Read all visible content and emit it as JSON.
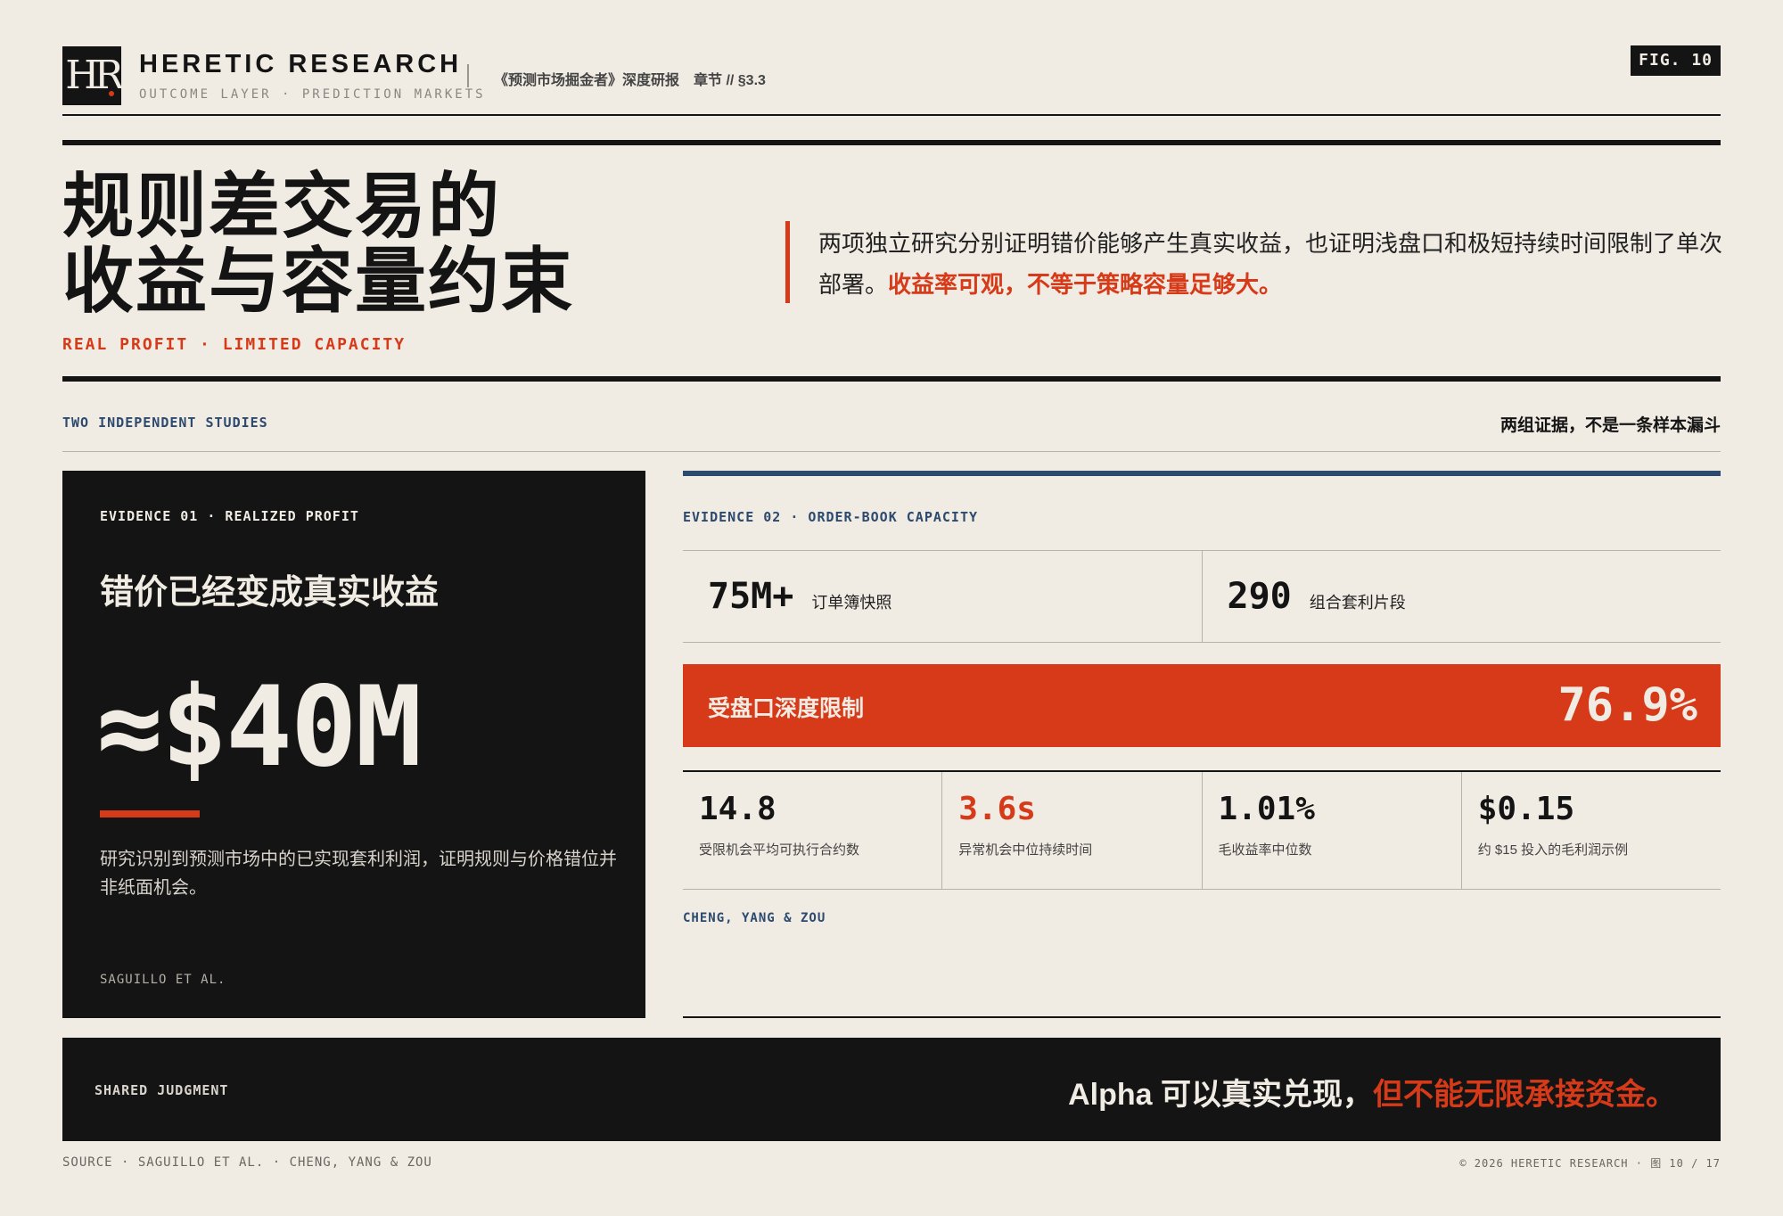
{
  "header": {
    "logo_text": "HR",
    "brand_name": "HERETIC RESEARCH",
    "brand_sub": "OUTCOME LAYER · PREDICTION MARKETS",
    "meta": "《预测市场掘金者》深度研报　章节 // §3.3",
    "fig_badge": "FIG. 10"
  },
  "hero": {
    "title_line1": "规则差交易的",
    "title_line2": "收益与容量约束",
    "tagline": "REAL PROFIT · LIMITED CAPACITY",
    "desc_plain": "两项独立研究分别证明错价能够产生真实收益，也证明浅盘口和极短持续时间限制了单次部署。",
    "desc_highlight": "收益率可观，不等于策略容量足够大。"
  },
  "section": {
    "left_label": "TWO INDEPENDENT STUDIES",
    "right_label": "两组证据，不是一条样本漏斗"
  },
  "evidence1": {
    "label": "EVIDENCE 01 · REALIZED PROFIT",
    "title": "错价已经变成真实收益",
    "big_value": "≈$40M",
    "description": "研究识别到预测市场中的已实现套利利润，证明规则与价格错位并非纸面机会。",
    "source": "SAGUILLO ET AL."
  },
  "evidence2": {
    "label": "EVIDENCE 02 · ORDER-BOOK CAPACITY",
    "stats": [
      {
        "value": "75M+",
        "label": "订单簿快照"
      },
      {
        "value": "290",
        "label": "组合套利片段"
      }
    ],
    "highlight": {
      "label": "受盘口深度限制",
      "value": "76.9%"
    },
    "metrics": [
      {
        "value": "14.8",
        "label": "受限机会平均可执行合约数"
      },
      {
        "value": "3.6s",
        "label": "异常机会中位持续时间"
      },
      {
        "value": "1.01%",
        "label": "毛收益率中位数"
      },
      {
        "value": "$0.15",
        "label": "约 $15 投入的毛利润示例"
      }
    ],
    "source": "CHENG, YANG & ZOU"
  },
  "judgment": {
    "label": "SHARED JUDGMENT",
    "text_plain": "Alpha 可以真实兑现，",
    "text_highlight": "但不能无限承接资金。"
  },
  "footer": {
    "left": "SOURCE · SAGUILLO ET AL. · CHENG, YANG & ZOU",
    "right": "© 2026 HERETIC RESEARCH · 图 10 / 17"
  },
  "colors": {
    "background": "#f0ebe3",
    "ink": "#141414",
    "accent_red": "#d63a19",
    "accent_blue": "#2c4a6e"
  }
}
